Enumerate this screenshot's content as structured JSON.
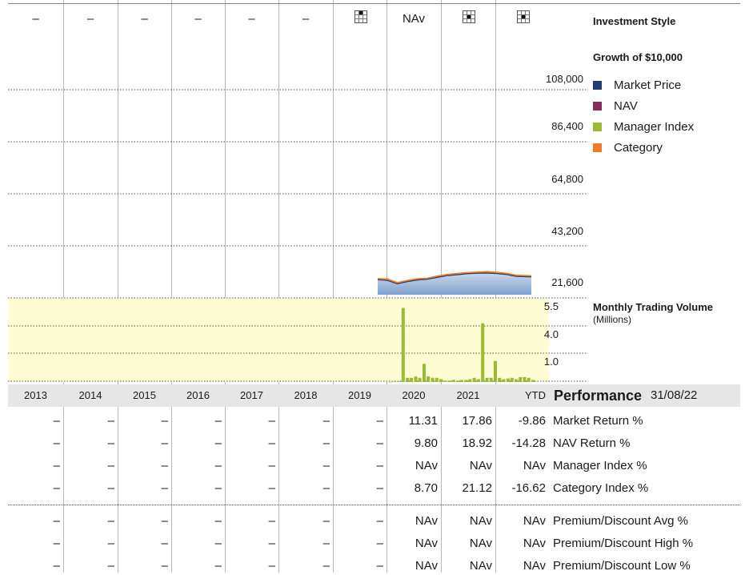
{
  "header_row": {
    "cells": [
      "–",
      "–",
      "–",
      "–",
      "–",
      "–",
      "style-box-icon",
      "NAv",
      "style-box-icon",
      "style-box-icon"
    ],
    "style_box_marks": {
      "6": "top-middle",
      "8": "middle-middle",
      "9": "middle-middle"
    },
    "title": "Investment Style"
  },
  "growth": {
    "title": "Growth of $10,000",
    "ytick_labels": [
      "108,000",
      "86,400",
      "64,800",
      "43,200",
      "21,600"
    ]
  },
  "legend": [
    {
      "label": "Market Price",
      "color": "#1f3f6e"
    },
    {
      "label": "NAV",
      "color": "#8b2d5c"
    },
    {
      "label": "Manager Index",
      "color": "#9ab934"
    },
    {
      "label": "Category",
      "color": "#f07a26"
    }
  ],
  "volume": {
    "title": "Monthly Trading Volume",
    "subtitle": "(Millions)",
    "ytick_labels": [
      "5.5",
      "4.0",
      "1.0"
    ]
  },
  "years": [
    "2013",
    "2014",
    "2015",
    "2016",
    "2017",
    "2018",
    "2019",
    "2020",
    "2021",
    "YTD"
  ],
  "performance": {
    "title": "Performance",
    "date": "31/08/22",
    "rows": [
      {
        "label": "Market Return %",
        "values": [
          "–",
          "–",
          "–",
          "–",
          "–",
          "–",
          "–",
          "11.31",
          "17.86",
          "-9.86"
        ]
      },
      {
        "label": "NAV Return %",
        "values": [
          "–",
          "–",
          "–",
          "–",
          "–",
          "–",
          "–",
          "9.80",
          "18.92",
          "-14.28"
        ]
      },
      {
        "label": "Manager Index %",
        "values": [
          "–",
          "–",
          "–",
          "–",
          "–",
          "–",
          "–",
          "NAv",
          "NAv",
          "NAv"
        ]
      },
      {
        "label": "Category Index %",
        "values": [
          "–",
          "–",
          "–",
          "–",
          "–",
          "–",
          "–",
          "8.70",
          "21.12",
          "-16.62"
        ]
      },
      {
        "label": "Premium/Discount Avg %",
        "values": [
          "–",
          "–",
          "–",
          "–",
          "–",
          "–",
          "–",
          "NAv",
          "NAv",
          "NAv"
        ]
      },
      {
        "label": "Premium/Discount High %",
        "values": [
          "–",
          "–",
          "–",
          "–",
          "–",
          "–",
          "–",
          "NAv",
          "NAv",
          "NAv"
        ]
      },
      {
        "label": "Premium/Discount Low %",
        "values": [
          "–",
          "–",
          "–",
          "–",
          "–",
          "–",
          "–",
          "NAv",
          "NAv",
          "NAv"
        ]
      }
    ]
  },
  "colors": {
    "market_price": "#1f3f6e",
    "nav": "#8b2d5c",
    "manager_index": "#9ab934",
    "category": "#f07a26",
    "area_fill_top": "#c9d7ea",
    "area_fill_bottom": "#7fa1cd",
    "volume_bg": "#fcfbd2",
    "volume_bar": "#9ab934",
    "year_band": "#e6e6e6"
  },
  "chart_data": [
    {
      "type": "area",
      "title": "Growth of $10,000",
      "ylim": [
        0,
        108000
      ],
      "yticks": [
        21600,
        43200,
        64800,
        86400,
        108000
      ],
      "x_range": [
        "2020-01",
        "2022-08"
      ],
      "series": [
        {
          "name": "Market Price",
          "x": [
            "2020-01",
            "2020-03",
            "2020-05",
            "2020-07",
            "2020-09",
            "2020-11",
            "2021-01",
            "2021-03",
            "2021-05",
            "2021-07",
            "2021-09",
            "2021-11",
            "2022-01",
            "2022-03",
            "2022-05",
            "2022-08"
          ],
          "values": [
            15100,
            14800,
            13400,
            14300,
            15000,
            15300,
            16100,
            16800,
            17200,
            17600,
            17800,
            17900,
            17700,
            17300,
            16500,
            16300
          ]
        },
        {
          "name": "Category",
          "x": [
            "2020-01",
            "2020-03",
            "2020-05",
            "2020-07",
            "2020-09",
            "2020-11",
            "2021-01",
            "2021-03",
            "2021-05",
            "2021-07",
            "2021-09",
            "2021-11",
            "2022-01",
            "2022-03",
            "2022-05",
            "2022-08"
          ],
          "values": [
            15500,
            15300,
            13800,
            14700,
            15400,
            15600,
            16600,
            17200,
            17600,
            18000,
            18200,
            18400,
            18100,
            17700,
            16900,
            16700
          ]
        }
      ]
    },
    {
      "type": "bar",
      "title": "Monthly Trading Volume",
      "ylabel": "(Millions)",
      "yticks": [
        1.0,
        4.0,
        5.5
      ],
      "x": [
        "2019-10",
        "2019-11",
        "2019-12",
        "2020-01",
        "2020-02",
        "2020-03",
        "2020-04",
        "2020-05",
        "2020-06",
        "2020-07",
        "2020-08",
        "2020-09",
        "2020-10",
        "2020-11",
        "2020-12",
        "2021-01",
        "2021-02",
        "2021-03",
        "2021-04",
        "2021-05",
        "2021-06",
        "2021-07",
        "2021-08",
        "2021-09",
        "2021-10",
        "2021-11",
        "2021-12",
        "2022-01",
        "2022-02",
        "2022-03",
        "2022-04",
        "2022-05",
        "2022-06",
        "2022-07",
        "2022-08"
      ],
      "values": [
        0.0,
        0.05,
        0.05,
        5.3,
        0.3,
        0.3,
        0.4,
        0.3,
        1.3,
        0.4,
        0.3,
        0.3,
        0.2,
        0.1,
        0.1,
        0.15,
        0.1,
        0.15,
        0.15,
        0.2,
        0.3,
        0.2,
        4.2,
        0.3,
        0.3,
        1.5,
        0.3,
        0.2,
        0.25,
        0.3,
        0.2,
        0.35,
        0.35,
        0.3,
        0.15
      ]
    }
  ]
}
